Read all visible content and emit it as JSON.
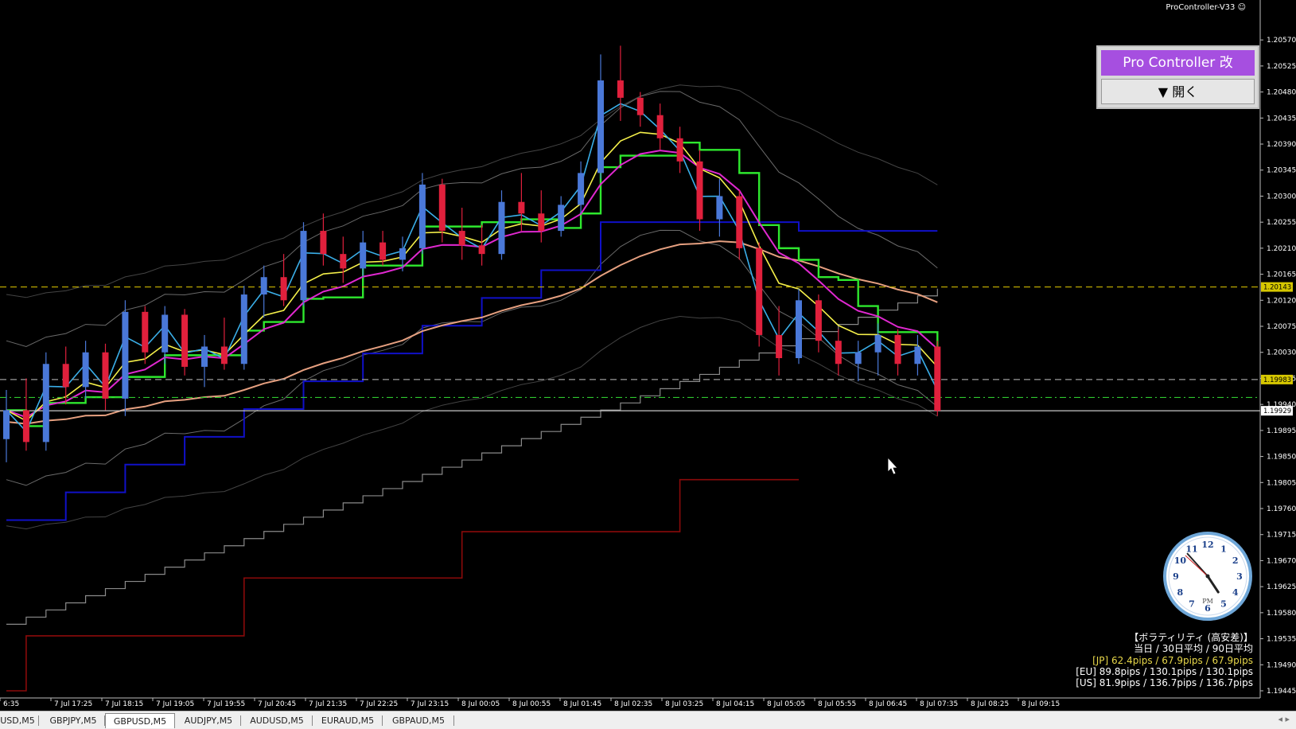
{
  "chart_data": {
    "type": "candlestick",
    "symbol": "GBPUSD,M5",
    "ylim": [
      1.19445,
      1.20595
    ],
    "y_ticks": [
      "1.20570",
      "1.20525",
      "1.20480",
      "1.20435",
      "1.20390",
      "1.20345",
      "1.20300",
      "1.20255",
      "1.20210",
      "1.20165",
      "1.20120",
      "1.20075",
      "1.20030",
      "1.19985",
      "1.19940",
      "1.19895",
      "1.19850",
      "1.19805",
      "1.19760",
      "1.19715",
      "1.19670",
      "1.19625",
      "1.19580",
      "1.19535",
      "1.19490",
      "1.19445"
    ],
    "x_ticks": [
      "6:35",
      "7 Jul 17:25",
      "7 Jul 18:15",
      "7 Jul 19:05",
      "7 Jul 19:55",
      "7 Jul 20:45",
      "7 Jul 21:35",
      "7 Jul 22:25",
      "7 Jul 23:15",
      "8 Jul 00:05",
      "8 Jul 00:55",
      "8 Jul 01:45",
      "8 Jul 02:35",
      "8 Jul 03:25",
      "8 Jul 04:15",
      "8 Jul 05:05",
      "8 Jul 05:55",
      "8 Jul 06:45",
      "8 Jul 07:35",
      "8 Jul 08:25",
      "8 Jul 09:15"
    ],
    "price_badges": [
      {
        "label": "1.20143",
        "value": 1.20143,
        "bg": "#d6c700",
        "fg": "#000000"
      },
      {
        "label": "1.19983",
        "value": 1.19983,
        "bg": "#d6c700",
        "fg": "#000000"
      },
      {
        "label": "1.19929",
        "value": 1.19929,
        "bg": "#ffffff",
        "fg": "#000000"
      }
    ],
    "horizontal_lines": [
      {
        "value": 1.20143,
        "color": "#c9b400",
        "style": "dashed"
      },
      {
        "value": 1.19983,
        "color": "#9a9a9a",
        "style": "dashed"
      },
      {
        "value": 1.19952,
        "color": "#2ec82e",
        "style": "dashdot"
      },
      {
        "value": 1.19929,
        "color": "#c8c8c8",
        "style": "solid"
      }
    ],
    "candles": [
      {
        "x": 0,
        "o": 1.1988,
        "h": 1.19965,
        "l": 1.1984,
        "c": 1.1993
      },
      {
        "x": 1,
        "o": 1.1993,
        "h": 1.19985,
        "l": 1.1986,
        "c": 1.19875
      },
      {
        "x": 2,
        "o": 1.19875,
        "h": 1.2003,
        "l": 1.1986,
        "c": 1.2001
      },
      {
        "x": 3,
        "o": 1.2001,
        "h": 1.2004,
        "l": 1.1994,
        "c": 1.1997
      },
      {
        "x": 4,
        "o": 1.1997,
        "h": 1.2005,
        "l": 1.1995,
        "c": 1.2003
      },
      {
        "x": 5,
        "o": 1.2003,
        "h": 1.20045,
        "l": 1.1993,
        "c": 1.1995
      },
      {
        "x": 6,
        "o": 1.1995,
        "h": 1.2012,
        "l": 1.1992,
        "c": 1.201
      },
      {
        "x": 7,
        "o": 1.201,
        "h": 1.2011,
        "l": 1.2001,
        "c": 1.2003
      },
      {
        "x": 8,
        "o": 1.2003,
        "h": 1.2011,
        "l": 1.2001,
        "c": 1.20095
      },
      {
        "x": 9,
        "o": 1.20095,
        "h": 1.20105,
        "l": 1.1999,
        "c": 1.20005
      },
      {
        "x": 10,
        "o": 1.20005,
        "h": 1.2006,
        "l": 1.1997,
        "c": 1.2004
      },
      {
        "x": 11,
        "o": 1.2004,
        "h": 1.2009,
        "l": 1.2,
        "c": 1.2001
      },
      {
        "x": 12,
        "o": 1.2001,
        "h": 1.20145,
        "l": 1.2,
        "c": 1.2013
      },
      {
        "x": 13,
        "o": 1.2013,
        "h": 1.2018,
        "l": 1.2009,
        "c": 1.2016
      },
      {
        "x": 14,
        "o": 1.2016,
        "h": 1.202,
        "l": 1.2011,
        "c": 1.2012
      },
      {
        "x": 15,
        "o": 1.2012,
        "h": 1.20255,
        "l": 1.2011,
        "c": 1.2024
      },
      {
        "x": 16,
        "o": 1.2024,
        "h": 1.2027,
        "l": 1.2018,
        "c": 1.202
      },
      {
        "x": 17,
        "o": 1.202,
        "h": 1.2023,
        "l": 1.2015,
        "c": 1.20175
      },
      {
        "x": 18,
        "o": 1.20175,
        "h": 1.2024,
        "l": 1.2016,
        "c": 1.2022
      },
      {
        "x": 19,
        "o": 1.2022,
        "h": 1.2024,
        "l": 1.2018,
        "c": 1.2019
      },
      {
        "x": 20,
        "o": 1.2019,
        "h": 1.2023,
        "l": 1.2017,
        "c": 1.2021
      },
      {
        "x": 21,
        "o": 1.2021,
        "h": 1.2034,
        "l": 1.202,
        "c": 1.2032
      },
      {
        "x": 22,
        "o": 1.2032,
        "h": 1.2033,
        "l": 1.2022,
        "c": 1.2024
      },
      {
        "x": 23,
        "o": 1.2024,
        "h": 1.2028,
        "l": 1.2019,
        "c": 1.20215
      },
      {
        "x": 24,
        "o": 1.20215,
        "h": 1.2025,
        "l": 1.2018,
        "c": 1.202
      },
      {
        "x": 25,
        "o": 1.202,
        "h": 1.2031,
        "l": 1.2019,
        "c": 1.2029
      },
      {
        "x": 26,
        "o": 1.2029,
        "h": 1.2034,
        "l": 1.2024,
        "c": 1.2027
      },
      {
        "x": 27,
        "o": 1.2027,
        "h": 1.2031,
        "l": 1.2022,
        "c": 1.2024
      },
      {
        "x": 28,
        "o": 1.2024,
        "h": 1.203,
        "l": 1.2023,
        "c": 1.20285
      },
      {
        "x": 29,
        "o": 1.20285,
        "h": 1.2036,
        "l": 1.2027,
        "c": 1.2034
      },
      {
        "x": 30,
        "o": 1.2034,
        "h": 1.20545,
        "l": 1.2033,
        "c": 1.205
      },
      {
        "x": 31,
        "o": 1.205,
        "h": 1.2056,
        "l": 1.2043,
        "c": 1.2047
      },
      {
        "x": 32,
        "o": 1.2047,
        "h": 1.2048,
        "l": 1.2042,
        "c": 1.2044
      },
      {
        "x": 33,
        "o": 1.2044,
        "h": 1.2046,
        "l": 1.2038,
        "c": 1.204
      },
      {
        "x": 34,
        "o": 1.204,
        "h": 1.2042,
        "l": 1.2034,
        "c": 1.2036
      },
      {
        "x": 35,
        "o": 1.2036,
        "h": 1.2038,
        "l": 1.2024,
        "c": 1.2026
      },
      {
        "x": 36,
        "o": 1.2026,
        "h": 1.2033,
        "l": 1.2023,
        "c": 1.203
      },
      {
        "x": 37,
        "o": 1.203,
        "h": 1.2031,
        "l": 1.2019,
        "c": 1.2021
      },
      {
        "x": 38,
        "o": 1.2021,
        "h": 1.2022,
        "l": 1.2004,
        "c": 1.2006
      },
      {
        "x": 39,
        "o": 1.2006,
        "h": 1.2011,
        "l": 1.1999,
        "c": 1.2002
      },
      {
        "x": 40,
        "o": 1.2002,
        "h": 1.2014,
        "l": 1.2001,
        "c": 1.2012
      },
      {
        "x": 41,
        "o": 1.2012,
        "h": 1.2013,
        "l": 1.2003,
        "c": 1.2005
      },
      {
        "x": 42,
        "o": 1.2005,
        "h": 1.2007,
        "l": 1.1999,
        "c": 1.2001
      },
      {
        "x": 43,
        "o": 1.2001,
        "h": 1.2005,
        "l": 1.1998,
        "c": 1.2003
      },
      {
        "x": 44,
        "o": 1.2003,
        "h": 1.2008,
        "l": 1.1999,
        "c": 1.2006
      },
      {
        "x": 45,
        "o": 1.2006,
        "h": 1.2007,
        "l": 1.1999,
        "c": 1.2001
      },
      {
        "x": 46,
        "o": 1.2001,
        "h": 1.2006,
        "l": 1.1999,
        "c": 1.2004
      },
      {
        "x": 47,
        "o": 1.2004,
        "h": 1.2005,
        "l": 1.1992,
        "c": 1.19929
      }
    ]
  },
  "indicator_title": "ProController-V33 ☺",
  "controller": {
    "title": "Pro Controller 改",
    "open_label": "▼ 開く",
    "title_bg": "#a64fe0"
  },
  "clock": {
    "numbers": [
      "12",
      "1",
      "2",
      "3",
      "4",
      "5",
      "6",
      "7",
      "8",
      "9",
      "10",
      "11"
    ],
    "period": "PM",
    "time": "16:53"
  },
  "volatility": {
    "title": "【ボラティリティ (高安差)】",
    "header": "当日 / 30日平均 / 90日平均",
    "jp": "[JP] 62.4pips / 67.9pips / 67.9pips",
    "eu": "[EU] 89.8pips / 130.1pips / 130.1pips",
    "us": "[US] 81.9pips / 136.7pips / 136.7pips",
    "jp_color": "#e8d84a"
  },
  "tabs": {
    "items": [
      "USD,M5",
      "GBPJPY,M5",
      "GBPUSD,M5",
      "AUDJPY,M5",
      "AUDUSD,M5",
      "EURAUD,M5",
      "GBPAUD,M5"
    ],
    "active": "GBPUSD,M5",
    "nav": "◂ ▸"
  },
  "colors": {
    "bull": "#4a78d8",
    "bear": "#e0203c",
    "ma_fast": "#3aaee8",
    "ma_yellow": "#f5f04a",
    "ma_magenta": "#e028d0",
    "ichimoku_green": "#2ee82e",
    "ma_salmon": "#e6a080",
    "channel_blue": "#1010c8",
    "channel_red": "#8a0a0a",
    "band_gray": "#6a6a6a"
  }
}
